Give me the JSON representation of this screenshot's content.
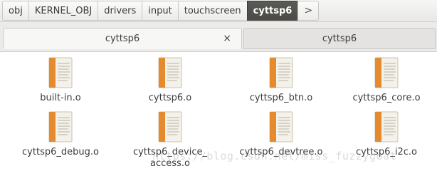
{
  "breadcrumb": {
    "items": [
      "obj",
      "KERNEL_OBJ",
      "drivers",
      "input",
      "touchscreen",
      "cyttsp6"
    ],
    "next_icon": "chevron-right-icon",
    "next_glyph": ">"
  },
  "tabs": [
    {
      "label": "cyttsp6",
      "close_glyph": "×"
    },
    {
      "label": "cyttsp6"
    }
  ],
  "files": [
    {
      "name": "built-in.o",
      "icon": "text-file-icon"
    },
    {
      "name": "cyttsp6.o",
      "icon": "text-file-icon"
    },
    {
      "name": "cyttsp6_btn.o",
      "icon": "text-file-icon"
    },
    {
      "name": "cyttsp6_core.o",
      "icon": "text-file-icon"
    },
    {
      "name": "cyttsp6_debug.o",
      "icon": "text-file-icon"
    },
    {
      "name": "cyttsp6_device_access.o",
      "line1": "cyttsp6_device_",
      "line2": "access.o",
      "icon": "text-file-icon"
    },
    {
      "name": "cyttsp6_devtree.o",
      "icon": "text-file-icon"
    },
    {
      "name": "cyttsp6_i2c.o",
      "icon": "text-file-icon"
    }
  ],
  "watermark": "https://blog.csdn.net/miss_fuzzygoat",
  "colors": {
    "active_crumb": "#4f4f4c",
    "file_icon_orange": "#e68a2e",
    "file_icon_paper": "#f4f1ea"
  }
}
